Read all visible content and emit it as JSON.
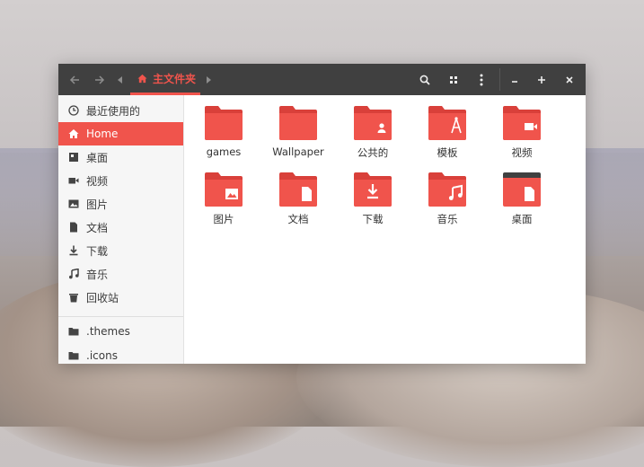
{
  "colors": {
    "accent": "#f0544c",
    "folder": "#f0544c",
    "folder_tab": "#d9403a",
    "headerbar": "#404040"
  },
  "headerbar": {
    "back_icon": "arrow-left-icon",
    "forward_icon": "arrow-right-icon",
    "breadcrumb_label": "主文件夹",
    "breadcrumb_icon": "home-icon"
  },
  "sidebar": {
    "items": [
      {
        "label": "最近使用的",
        "icon": "clock-icon"
      },
      {
        "label": "Home",
        "icon": "home-icon",
        "active": true
      },
      {
        "label": "桌面",
        "icon": "desktop-icon"
      },
      {
        "label": "视频",
        "icon": "video-icon"
      },
      {
        "label": "图片",
        "icon": "image-icon"
      },
      {
        "label": "文档",
        "icon": "document-icon"
      },
      {
        "label": "下载",
        "icon": "download-icon"
      },
      {
        "label": "音乐",
        "icon": "music-icon"
      },
      {
        "label": "回收站",
        "icon": "trash-icon"
      },
      {
        "label": ".themes",
        "icon": "folder-icon"
      },
      {
        "label": ".icons",
        "icon": "folder-icon"
      }
    ]
  },
  "files": [
    {
      "name": "games",
      "emblem": "none"
    },
    {
      "name": "Wallpaper",
      "emblem": "none"
    },
    {
      "name": "公共的",
      "emblem": "user-icon"
    },
    {
      "name": "模板",
      "emblem": "template-icon"
    },
    {
      "name": "视频",
      "emblem": "video-icon"
    },
    {
      "name": "图片",
      "emblem": "image-icon"
    },
    {
      "name": "文档",
      "emblem": "document-icon"
    },
    {
      "name": "下载",
      "emblem": "download-icon"
    },
    {
      "name": "音乐",
      "emblem": "music-icon"
    },
    {
      "name": "桌面",
      "emblem": "desktop-icon"
    }
  ]
}
